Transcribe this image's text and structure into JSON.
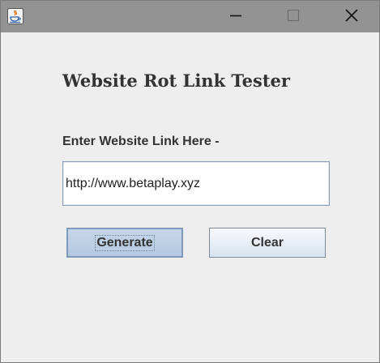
{
  "window": {
    "app_icon": "java-cup-icon",
    "controls": {
      "minimize_icon": "minimize-icon",
      "maximize_icon": "maximize-icon",
      "close_icon": "close-icon"
    }
  },
  "form": {
    "heading": "Website Rot Link Tester",
    "prompt": "Enter Website Link Here -",
    "url_value": "http://www.betaplay.xyz",
    "generate_label": "Generate",
    "clear_label": "Clear"
  },
  "colors": {
    "titlebar": "#939393",
    "window_bg": "#eeeeee",
    "focused_button_bg": "#b8cce4",
    "button_bg": "#e8eef5"
  }
}
